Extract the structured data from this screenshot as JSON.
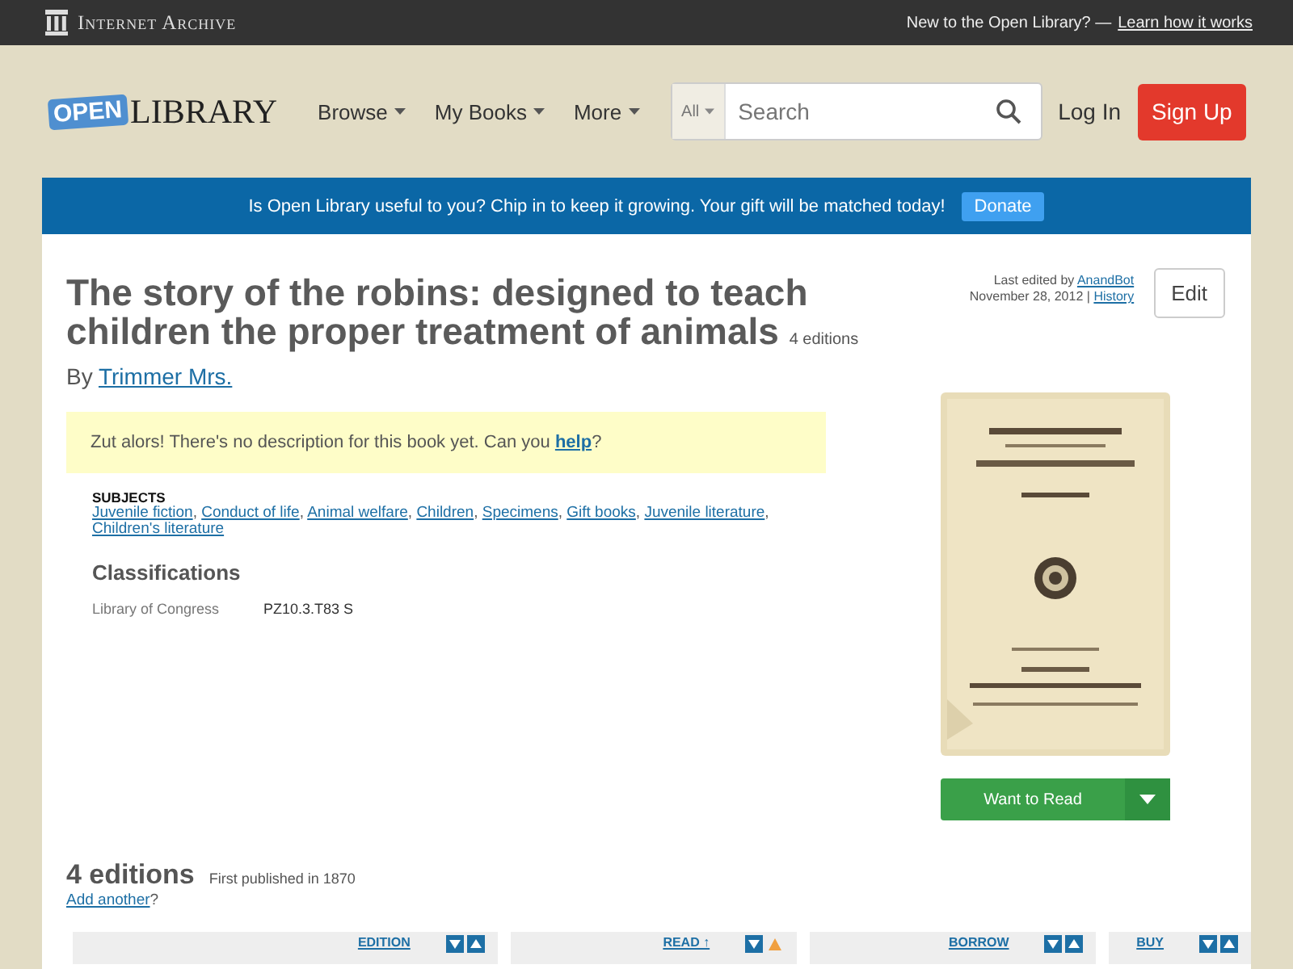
{
  "topbar": {
    "brand": "Internet Archive",
    "prompt": "New to the Open Library? —",
    "prompt_link": "Learn how it works"
  },
  "header": {
    "logo_badge": "OPEN",
    "logo_word": "LIBRARY",
    "nav": [
      "Browse",
      "My Books",
      "More"
    ],
    "search": {
      "scope": "All",
      "placeholder": "Search"
    },
    "login": "Log In",
    "signup": "Sign Up"
  },
  "banner": {
    "text": "Is Open Library useful to you? Chip in to keep it growing. Your gift will be matched today!",
    "button": "Donate"
  },
  "book": {
    "title": "The story of the robins: designed to teach children the proper treatment of animals",
    "editions_count": "4 editions",
    "by": "By",
    "author": "Trimmer Mrs.",
    "last_edited": "Last edited by",
    "editor": "AnandBot",
    "date": "November 28, 2012 |",
    "history": "History",
    "edit": "Edit",
    "description": "Zut alors! There's no description for this book yet. Can you",
    "description_link": "help",
    "description_end": "?",
    "subjects_heading": "SUBJECTS",
    "subject_separator": ",",
    "subjects": [
      "Juvenile fiction",
      "Conduct of life",
      "Animal welfare",
      "Children",
      "Specimens",
      "Gift books",
      "Juvenile literature",
      "Children's literature"
    ],
    "classifications_heading": "Classifications",
    "classifications": [
      {
        "label": "Library of Congress",
        "value": "PZ10.3.T83 S"
      }
    ],
    "want_to_read": "Want to Read"
  },
  "editions": {
    "heading": "4 editions",
    "first_published": "First published in 1870",
    "add_link": "Add another",
    "add_end": "?",
    "columns": [
      {
        "label": "EDITION",
        "sorted": false
      },
      {
        "label": "READ ↑",
        "sorted": true
      },
      {
        "label": "BORROW",
        "sorted": false
      },
      {
        "label": "BUY",
        "sorted": false
      }
    ]
  }
}
